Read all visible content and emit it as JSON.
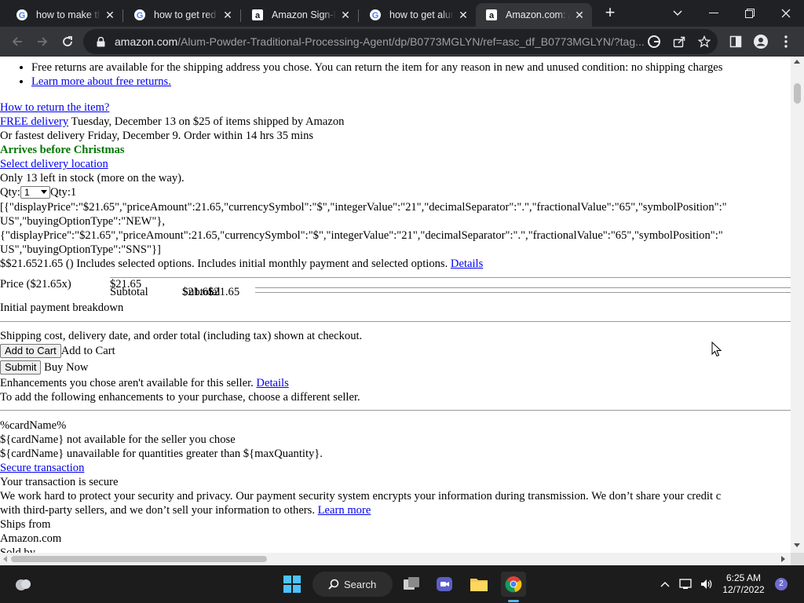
{
  "browser": {
    "tabs": [
      {
        "title": "how to make the",
        "icon": "google-icon"
      },
      {
        "title": "how to get red p",
        "icon": "google-icon"
      },
      {
        "title": "Amazon Sign-In",
        "icon": "amazon-icon"
      },
      {
        "title": "how to get alum",
        "icon": "google-icon"
      },
      {
        "title": "Amazon.com: Al",
        "icon": "amazon-icon",
        "active": true
      }
    ],
    "url_host": "amazon.com",
    "url_path": "/Alum-Powder-Traditional-Processing-Agent/dp/B0773MGLYN/ref=asc_df_B0773MGLYN/?tag..."
  },
  "page": {
    "bullet_returns": "Free returns are available for the shipping address you chose. You can return the item for any reason in new and unused condition: no shipping charges",
    "bullet_learn_more": "Learn more about free returns.",
    "how_to_return": "How to return the item?",
    "free_delivery_link": "FREE delivery",
    "free_delivery_rest": " Tuesday, December 13 on $25 of items shipped by Amazon",
    "fastest_delivery": "Or fastest delivery Friday, December 9. Order within 14 hrs 35 mins",
    "arrives": "Arrives before Christmas",
    "select_location": "Select delivery location",
    "stock": "Only 13 left in stock (more on the way).",
    "qty_label": "Qty:",
    "qty_value": "1",
    "qty_text": "Qty:1",
    "json_line1": "[{\"displayPrice\":\"$21.65\",\"priceAmount\":21.65,\"currencySymbol\":\"$\",\"integerValue\":\"21\",\"decimalSeparator\":\".\",\"fractionalValue\":\"65\",\"symbolPosition\":\"",
    "json_line2": "US\",\"buyingOptionType\":\"NEW\"},",
    "json_line3": "{\"displayPrice\":\"$21.65\",\"priceAmount\":21.65,\"currencySymbol\":\"$\",\"integerValue\":\"21\",\"decimalSeparator\":\".\",\"fractionalValue\":\"65\",\"symbolPosition\":\"",
    "json_line4": "US\",\"buyingOptionType\":\"SNS\"}]",
    "includes_text": "$$21.6521.65 () Includes selected options. Includes initial monthly payment and selected options.",
    "details_link": "Details",
    "price_label": "Price ($21.65x)",
    "price_value": "$21.65",
    "subtotal_label": "Subtotal",
    "subtotal_overlap_a": "$21.65",
    "subtotal_overlap_b": "Subtotal",
    "subtotal_value": "$21.65",
    "initial_payment": "Initial payment breakdown",
    "shipping_note": "Shipping cost, delivery date, and order total (including tax) shown at checkout.",
    "add_to_cart_btn": "Add to Cart",
    "add_to_cart_text": "Add to Cart",
    "submit_btn": "Submit",
    "buy_now_text": " Buy Now",
    "enhancements_text": "Enhancements you chose aren't available for this seller.",
    "enhancements_link": "Details",
    "different_seller": "To add the following enhancements to your purchase, choose a different seller.",
    "card_name": "%cardName%",
    "card_not_available": "${cardName} not available for the seller you chose",
    "card_unavailable_qty": "${cardName} unavailable for quantities greater than ${maxQuantity}.",
    "secure_transaction": " Secure transaction",
    "transaction_secure": "Your transaction is secure",
    "security_line1": "We work hard to protect your security and privacy. Our payment security system encrypts your information during transmission. We don’t share your credit c",
    "security_line2": "with third-party sellers, and we don’t sell your information to others.",
    "learn_more": "Learn more",
    "ships_from": "Ships from",
    "ships_from_value": "Amazon.com",
    "sold_by": "Sold by"
  },
  "taskbar": {
    "search_label": "Search",
    "time": "6:25 AM",
    "date": "12/7/2022",
    "notification_count": "2"
  }
}
